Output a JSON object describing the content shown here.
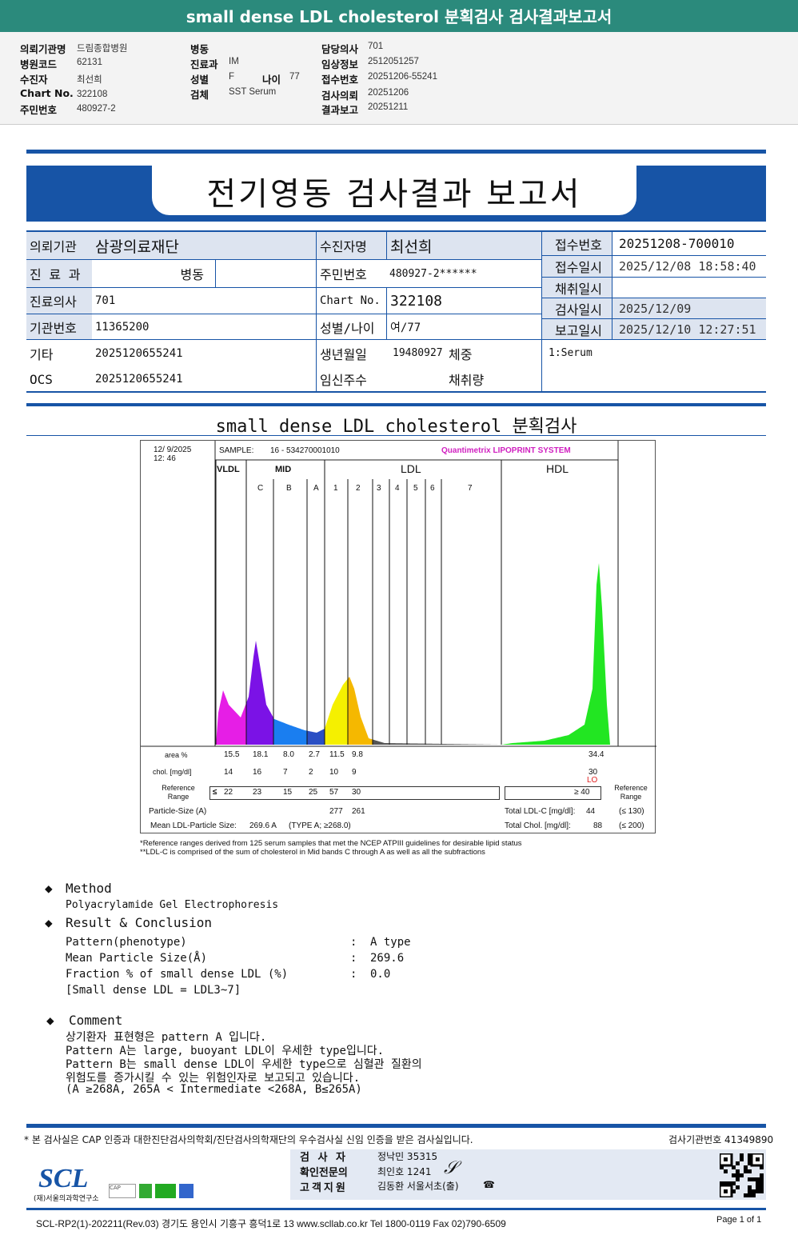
{
  "header": {
    "title": "small dense LDL cholesterol 분획검사 검사결과보고서"
  },
  "info": {
    "col1": [
      {
        "label": "의뢰기관명",
        "value": "드림종합병원"
      },
      {
        "label": "병원코드",
        "value": "62131"
      },
      {
        "label": "수진자",
        "value": "최선희"
      },
      {
        "label": "Chart No.",
        "value": "322108"
      },
      {
        "label": "주민번호",
        "value": "480927-2"
      }
    ],
    "col2": [
      {
        "label": "병동",
        "value": ""
      },
      {
        "label": "진료과",
        "value": "IM"
      },
      {
        "label": "성별",
        "value": "F"
      },
      {
        "label": "검체",
        "value": "SST Serum"
      }
    ],
    "age_label": "나이",
    "age_value": "77",
    "col3": [
      {
        "label": "담당의사",
        "value": "701"
      },
      {
        "label": "임상정보",
        "value": "2512051257"
      },
      {
        "label": "접수번호",
        "value": "20251206-55241"
      },
      {
        "label": "검사의뢰",
        "value": "20251206"
      },
      {
        "label": "결과보고",
        "value": "20251211"
      }
    ]
  },
  "report": {
    "title": "전기영동 검사결과 보고서"
  },
  "table": {
    "left": [
      {
        "label": "의뢰기관",
        "value": "삼광의료재단"
      },
      {
        "label": "진 료 과",
        "value": "병동",
        "extra": ""
      },
      {
        "label": "진료의사",
        "value": "701"
      },
      {
        "label": "기관번호",
        "value": "11365200"
      },
      {
        "label": "기타",
        "value": "2025120655241"
      },
      {
        "label": "OCS",
        "value": "2025120655241"
      }
    ],
    "mid": [
      {
        "label": "수진자명",
        "value": "최선희"
      },
      {
        "label": "주민번호",
        "value": "480927-2******"
      },
      {
        "label": "Chart No.",
        "value": "322108"
      },
      {
        "label": "성별/나이",
        "value": "여/77"
      },
      {
        "label": "생년월일",
        "value": "19480927",
        "extra": "체중"
      },
      {
        "label": "임신주수",
        "value": "",
        "extra": "채취량"
      }
    ],
    "right": [
      {
        "label": "접수번호",
        "value": "20251208-700010"
      },
      {
        "label": "접수일시",
        "value": "2025/12/08 18:58:40"
      },
      {
        "label": "채취일시",
        "value": ""
      },
      {
        "label": "검사일시",
        "value": "2025/12/09"
      },
      {
        "label": "보고일시",
        "value": "2025/12/10 12:27:51"
      }
    ],
    "specimen": "1:Serum"
  },
  "section_title": "small dense LDL cholesterol 분획검사",
  "chart_data": {
    "type": "area",
    "date": "12/ 9/2025",
    "time": "12: 46",
    "sample_label": "SAMPLE:",
    "sample": "16 - 534270001010",
    "brand": "Quantimetrix LIPOPRINT",
    "brand_suffix": "SYSTEM",
    "groups": [
      "VLDL",
      "MID",
      "LDL",
      "HDL"
    ],
    "bands": [
      "C",
      "B",
      "A",
      "1",
      "2",
      "3",
      "4",
      "5",
      "6",
      "7"
    ],
    "colors": {
      "VLDL": "#e61ee6",
      "C": "#7b12e6",
      "B": "#1a7ef0",
      "A": "#2a4fc4",
      "1": "#f5f000",
      "2": "#f5b800",
      "HDL": "#22e622"
    },
    "rows": {
      "area_label": "area %",
      "area": [
        "15.5",
        "18.1",
        "8.0",
        "2.7",
        "11.5",
        "9.8"
      ],
      "area_hdl": "34.4",
      "chol_label": "chol. [mg/dl]",
      "chol": [
        "14",
        "16",
        "7",
        "2",
        "10",
        "9"
      ],
      "chol_hdl": "30",
      "hdl_flag": "LO",
      "ref_label": "Reference Range",
      "ref_prefix": "≤",
      "ref": [
        "22",
        "23",
        "15",
        "25",
        "57",
        "30"
      ],
      "ref_hdl": "≥  40",
      "size_label": "Particle-Size (A)",
      "size": [
        "277",
        "261"
      ],
      "mean_label": "Mean LDL-Particle Size:",
      "mean": "269.6  A",
      "type": "(TYPE A; ≥268.0)",
      "ldl_label": "Total LDL-C  [mg/dl]:",
      "ldl": "44",
      "ldl_ref": "(≤ 130)",
      "tc_label": "Total Chol.  [mg/dl]:",
      "tc": "88",
      "tc_ref": "(≤ 200)"
    },
    "footnotes": [
      "*Reference ranges derived from 125 serum samples that met the NCEP ATPIII guidelines for desirable lipid status",
      "**LDL-C is comprised of the sum of cholesterol in Mid bands C through A as well as all the subfractions"
    ]
  },
  "method": {
    "title": "Method",
    "text": "Polyacrylamide Gel Electrophoresis"
  },
  "result": {
    "title": "Result & Conclusion",
    "items": [
      {
        "label": "Pattern(phenotype)",
        "value": "A type"
      },
      {
        "label": "Mean Particle Size(Å)",
        "value": "269.6"
      },
      {
        "label": "Fraction % of small dense LDL (%)",
        "value": "0.0"
      }
    ],
    "note": "[Small dense LDL = LDL3~7]"
  },
  "comment": {
    "title": "Comment",
    "lines": [
      "상기환자 표현형은 pattern A 입니다.",
      "Pattern A는 large, buoyant LDL이 우세한 type입니다.",
      "Pattern B는 small dense LDL이 우세한 type으로 심혈관 질환의",
      "위험도를 증가시킬 수 있는 위험인자로 보고되고 있습니다.",
      "(A ≥268A, 265A < Intermediate <268A, B≤265A)"
    ]
  },
  "footer": {
    "notice": "* 본 검사실은 CAP 인증과 대한진단검사의학회/진단검사의학재단의 우수검사실 신임 인증을 받은 검사실입니다.",
    "lab_no": "검사기관번호 41349890",
    "staff": [
      {
        "label": "검 사 자",
        "value": "정낙민 35315"
      },
      {
        "label": "확인전문의",
        "value": "최인호 1241"
      },
      {
        "label": "고객지원",
        "value": "김동환 서울서초(출)"
      }
    ],
    "logo": "SCL",
    "logo_sub": "(재)서울의과학연구소",
    "address": "SCL-RP2(1)-202211(Rev.03)  경기도 용인시 기흥구 흥덕1로 13  www.scllab.co.kr   Tel 1800-0119    Fax 02)790-6509",
    "page": "Page 1 of 1"
  }
}
